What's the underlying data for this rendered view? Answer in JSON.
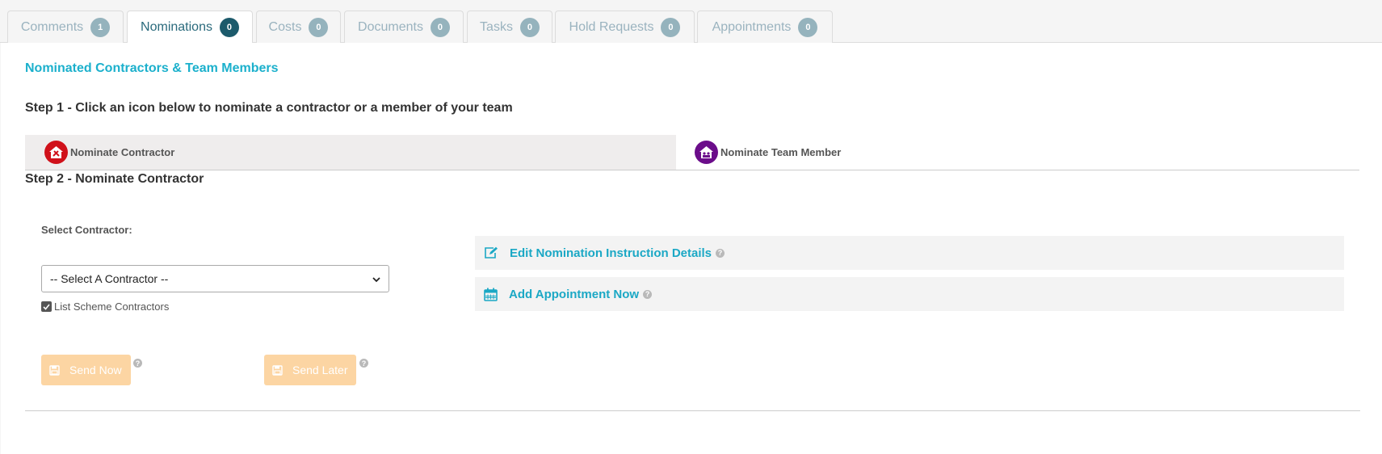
{
  "tabs": [
    {
      "label": "Comments",
      "count": "1"
    },
    {
      "label": "Nominations",
      "count": "0"
    },
    {
      "label": "Costs",
      "count": "0"
    },
    {
      "label": "Documents",
      "count": "0"
    },
    {
      "label": "Tasks",
      "count": "0"
    },
    {
      "label": "Hold Requests",
      "count": "0"
    },
    {
      "label": "Appointments",
      "count": "0"
    }
  ],
  "active_tab": "Nominations",
  "page": {
    "section_title": "Nominated Contractors & Team Members",
    "step1": "Step 1 - Click an icon below to nominate a contractor or a member of your team",
    "step2": "Step 2 - Nominate Contractor"
  },
  "nominate": {
    "contractor_label": "Nominate Contractor",
    "team_member_label": "Nominate Team Member",
    "selected": "Nominate Contractor"
  },
  "form": {
    "select_label": "Select Contractor:",
    "select_value": "-- Select A Contractor --",
    "checkbox_label": "List Scheme Contractors",
    "checkbox_checked": true
  },
  "buttons": {
    "send_now": "Send Now",
    "send_later": "Send Later"
  },
  "actions": {
    "edit_instructions": "Edit Nomination Instruction Details",
    "add_appointment": "Add Appointment Now"
  },
  "icons": {
    "contractor": "contractor-house-icon",
    "team_member": "team-house-icon",
    "edit": "edit-icon",
    "calendar": "calendar-icon",
    "save": "save-icon",
    "help": "help-icon"
  },
  "colors": {
    "accent": "#1bb0cc",
    "contractor_icon": "#d0111a",
    "team_icon": "#6b0d8a",
    "button_disabled": "#fcd5a3"
  }
}
